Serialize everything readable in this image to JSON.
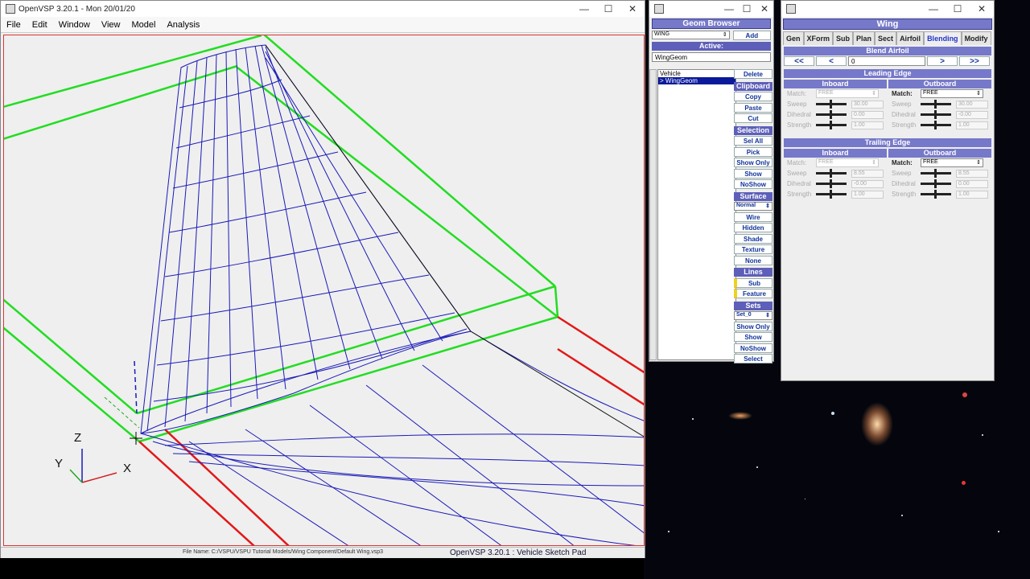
{
  "main_window": {
    "title": "OpenVSP 3.20.1 - Mon 20/01/20",
    "menu": [
      "File",
      "Edit",
      "Window",
      "View",
      "Model",
      "Analysis"
    ],
    "axes": {
      "z": "Z",
      "y": "Y",
      "x": "X"
    },
    "file_name": "File Name: C:/VSPU/VSPU Tutorial Models/Wing Component/Default Wing.vsp3",
    "status_title": "OpenVSP 3.20.1 : Vehicle Sketch Pad"
  },
  "geom_browser": {
    "title": "Geom Browser",
    "type_select": "WING",
    "add_label": "Add",
    "active_label": "Active:",
    "active_value": "WingGeom",
    "tree": [
      "Vehicle",
      "> WingGeom"
    ],
    "delete_label": "Delete",
    "clipboard": {
      "header": "Clipboard",
      "items": [
        "Copy",
        "Paste",
        "Cut"
      ]
    },
    "selection": {
      "header": "Selection",
      "items": [
        "Sel All",
        "Pick",
        "Show Only",
        "Show",
        "NoShow"
      ]
    },
    "surface": {
      "header": "Surface",
      "select": "Normal",
      "items": [
        "Wire",
        "Hidden",
        "Shade",
        "Texture",
        "None"
      ]
    },
    "lines": {
      "header": "Lines",
      "items": [
        "Sub",
        "Feature"
      ]
    },
    "sets": {
      "header": "Sets",
      "select": "Set_0",
      "items": [
        "Show Only",
        "Show",
        "NoShow",
        "Select"
      ]
    }
  },
  "wing": {
    "title": "Wing",
    "tabs": [
      "Gen",
      "XForm",
      "Sub",
      "Plan",
      "Sect",
      "Airfoil",
      "Blending",
      "Modify"
    ],
    "active_tab": "Blending",
    "blend_airfoil": "Blend Airfoil",
    "nav": [
      "<<",
      "<",
      ">",
      ">>"
    ],
    "index": "0",
    "leading_edge": {
      "header": "Leading Edge",
      "inboard": {
        "header": "Inboard",
        "match": "Match:",
        "match_value": "FREE",
        "sweep": "30.00",
        "dihedral": "0.00",
        "strength": "1.00"
      },
      "outboard": {
        "header": "Outboard",
        "match": "Match:",
        "match_value": "FREE",
        "sweep": "30.00",
        "dihedral": "-0.00",
        "strength": "1.00"
      }
    },
    "trailing_edge": {
      "header": "Trailing Edge",
      "inboard": {
        "header": "Inboard",
        "match": "Match:",
        "match_value": "FREE",
        "sweep": "8.55",
        "dihedral": "-0.00",
        "strength": "1.00"
      },
      "outboard": {
        "header": "Outboard",
        "match": "Match:",
        "match_value": "FREE",
        "sweep": "8.55",
        "dihedral": "0.00",
        "strength": "1.00"
      }
    },
    "labels": {
      "sweep": "Sweep",
      "dihedral": "Dihedral",
      "strength": "Strength"
    }
  }
}
